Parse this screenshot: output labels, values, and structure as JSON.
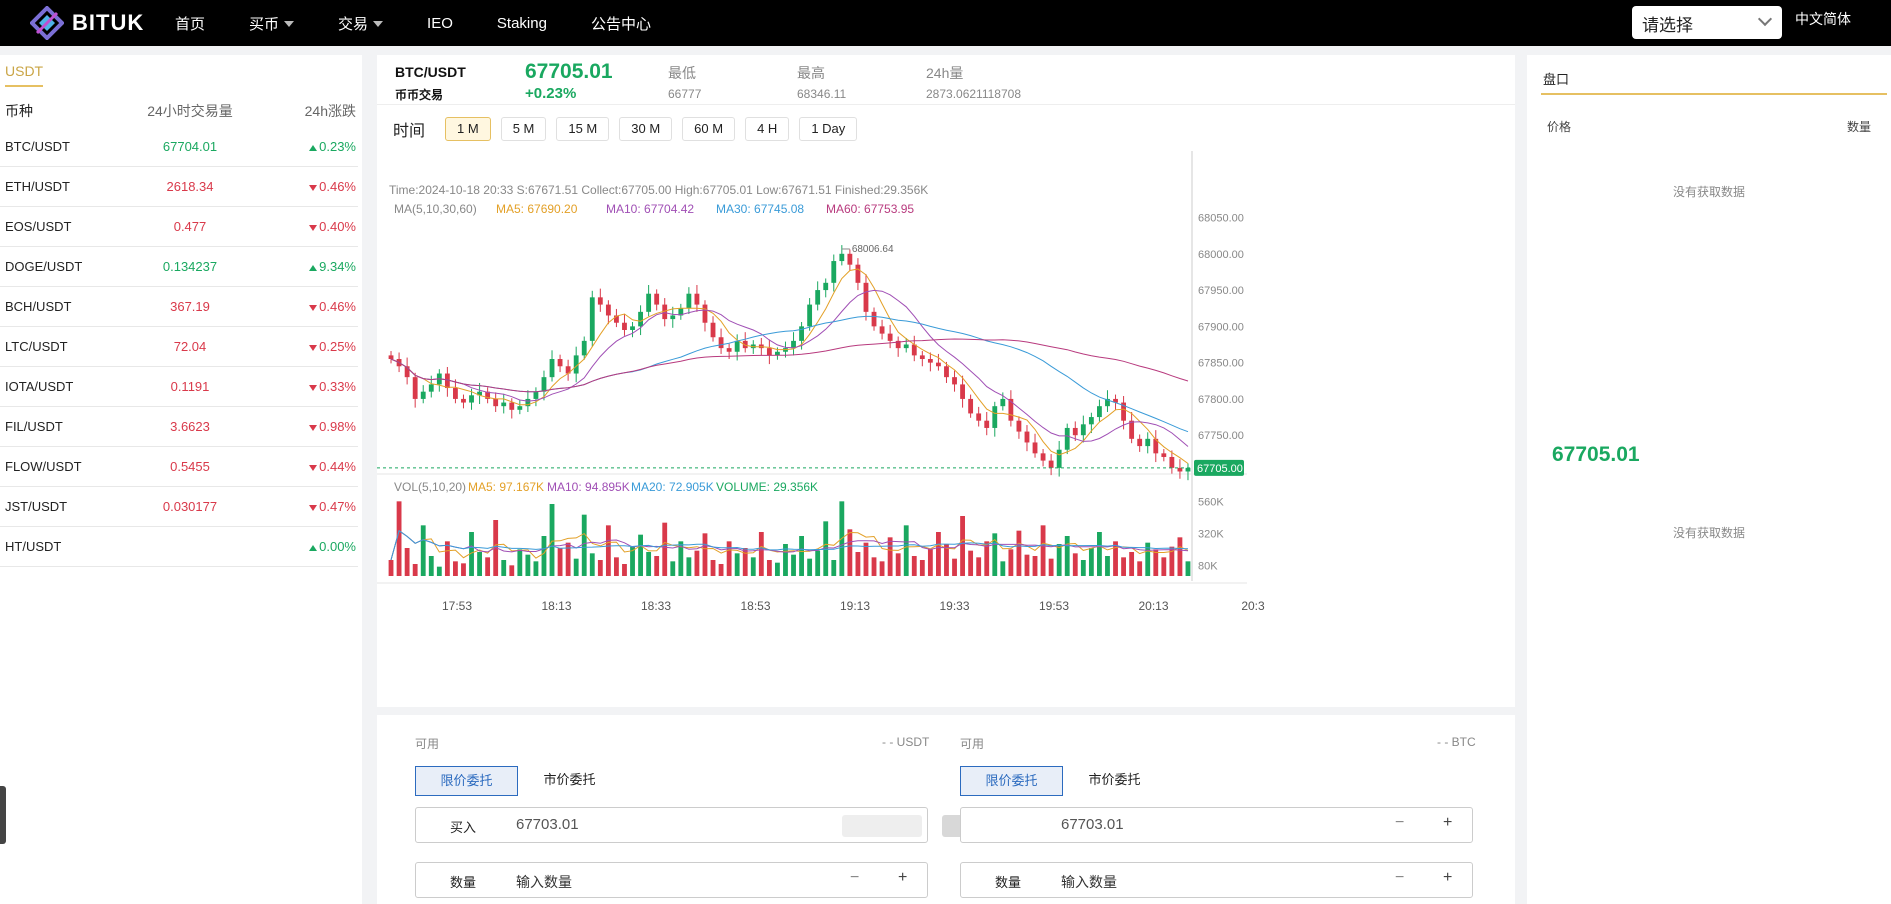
{
  "app": {
    "logo_text": "BITUK",
    "nav": [
      {
        "label": "首页",
        "has_caret": false
      },
      {
        "label": "买币",
        "has_caret": true
      },
      {
        "label": "交易",
        "has_caret": true
      },
      {
        "label": "IEO",
        "has_caret": false
      },
      {
        "label": "Staking",
        "has_caret": false
      },
      {
        "label": "公告中心",
        "has_caret": false
      }
    ],
    "select_placeholder": "请选择",
    "language": "中文简体"
  },
  "colors": {
    "up": "#1aa860",
    "down": "#d9394a",
    "accent": "#e6c062",
    "brand_blue": "#2c6bbf"
  },
  "markets": {
    "tab": "USDT",
    "headers": [
      "币种",
      "24小时交易量",
      "24h涨跌"
    ],
    "rows": [
      {
        "pair": "BTC/USDT",
        "volume": "67704.01",
        "change": "0.23%",
        "dir": "up"
      },
      {
        "pair": "ETH/USDT",
        "volume": "2618.34",
        "change": "0.46%",
        "dir": "down"
      },
      {
        "pair": "EOS/USDT",
        "volume": "0.477",
        "change": "0.40%",
        "dir": "down"
      },
      {
        "pair": "DOGE/USDT",
        "volume": "0.134237",
        "change": "9.34%",
        "dir": "up"
      },
      {
        "pair": "BCH/USDT",
        "volume": "367.19",
        "change": "0.46%",
        "dir": "down"
      },
      {
        "pair": "LTC/USDT",
        "volume": "72.04",
        "change": "0.25%",
        "dir": "down"
      },
      {
        "pair": "IOTA/USDT",
        "volume": "0.1191",
        "change": "0.33%",
        "dir": "down"
      },
      {
        "pair": "FIL/USDT",
        "volume": "3.6623",
        "change": "0.98%",
        "dir": "down"
      },
      {
        "pair": "FLOW/USDT",
        "volume": "0.5455",
        "change": "0.44%",
        "dir": "down"
      },
      {
        "pair": "JST/USDT",
        "volume": "0.030177",
        "change": "0.47%",
        "dir": "down"
      },
      {
        "pair": "HT/USDT",
        "volume": "",
        "change": "0.00%",
        "dir": "up"
      }
    ]
  },
  "ticker": {
    "pair": "BTC/USDT",
    "sub": "币币交易",
    "price": "67705.01",
    "change": "+0.23%",
    "low_label": "最低",
    "low": "66777",
    "high_label": "最高",
    "high": "68346.11",
    "vol_label": "24h量",
    "vol": "2873.0621118708"
  },
  "timeframes": {
    "label": "时间",
    "items": [
      "1 M",
      "5 M",
      "15 M",
      "30 M",
      "60 M",
      "4 H",
      "1 Day"
    ],
    "active": "1 M"
  },
  "chart_data": {
    "type": "candlestick",
    "info_line": "Time:2024-10-18 20:33    S:67671.51    Collect:67705.00    High:67705.01    Low:67671.51    Finished:29.356K",
    "ma_line": {
      "prefix": "MA(5,10,30,60)",
      "items": [
        {
          "text": "MA5: 67690.20",
          "color": "#e3a027"
        },
        {
          "text": "MA10: 67704.42",
          "color": "#a04fb5"
        },
        {
          "text": "MA30: 67745.08",
          "color": "#3a9bd8"
        },
        {
          "text": "MA60: 67753.95",
          "color": "#b83a7e"
        }
      ]
    },
    "price_ticks": [
      "68050.00",
      "68000.00",
      "67950.00",
      "67900.00",
      "67850.00",
      "67800.00",
      "67750.00"
    ],
    "ylim": [
      67680,
      68070
    ],
    "high_marker": "68006.64",
    "last_price_label": "67705.00",
    "last_price": 67705.0,
    "vol_line": {
      "prefix": "VOL(5,10,20)",
      "items": [
        {
          "text": "MA5: 97.167K",
          "color": "#e3a027"
        },
        {
          "text": "MA10: 94.895K",
          "color": "#a04fb5"
        },
        {
          "text": "MA20: 72.905K",
          "color": "#3a9bd8"
        },
        {
          "text": "VOLUME: 29.356K",
          "color": "#1aa860"
        }
      ]
    },
    "volume_ticks": [
      "560K",
      "320K",
      "80K"
    ],
    "x_ticks": [
      "17:53",
      "18:13",
      "18:33",
      "18:53",
      "19:13",
      "19:33",
      "19:53",
      "20:13",
      "20:3"
    ],
    "close_path": [
      67855,
      67845,
      67830,
      67800,
      67810,
      67820,
      67835,
      67815,
      67800,
      67795,
      67805,
      67810,
      67800,
      67790,
      67795,
      67785,
      67790,
      67800,
      67810,
      67830,
      67855,
      67845,
      67835,
      67860,
      67880,
      67940,
      67930,
      67915,
      67905,
      67895,
      67900,
      67920,
      67945,
      67930,
      67910,
      67915,
      67925,
      67945,
      67930,
      67905,
      67885,
      67870,
      67865,
      67880,
      67870,
      67875,
      67870,
      67860,
      67865,
      67870,
      67880,
      67900,
      67930,
      67950,
      67960,
      67990,
      68000,
      67985,
      67960,
      67920,
      67900,
      67890,
      67880,
      67870,
      67875,
      67860,
      67855,
      67850,
      67845,
      67830,
      67820,
      67800,
      67780,
      67770,
      67760,
      67790,
      67800,
      67770,
      67755,
      67740,
      67725,
      67715,
      67705,
      67730,
      67760,
      67750,
      67765,
      67775,
      67790,
      67800,
      67795,
      67770,
      67745,
      67735,
      67745,
      67725,
      67720,
      67705,
      67700,
      67705
    ],
    "volumes": [
      120,
      560,
      210,
      90,
      380,
      150,
      70,
      260,
      110,
      95,
      330,
      180,
      140,
      420,
      120,
      80,
      200,
      160,
      110,
      300,
      540,
      210,
      250,
      130,
      460,
      170,
      120,
      380,
      140,
      90,
      220,
      310,
      180,
      150,
      400,
      110,
      260,
      140,
      190,
      320,
      120,
      90,
      260,
      170,
      210,
      140,
      330,
      120,
      100,
      240,
      160,
      300,
      130,
      190,
      410,
      120,
      560,
      350,
      180,
      250,
      140,
      110,
      290,
      170,
      380,
      150,
      120,
      200,
      330,
      240,
      130,
      450,
      190,
      140,
      260,
      320,
      110,
      200,
      340,
      160,
      150,
      380,
      130,
      240,
      300,
      170,
      120,
      210,
      330,
      150,
      260,
      140,
      180,
      110,
      250,
      200,
      140,
      220,
      290,
      110
    ]
  },
  "order": {
    "available_label": "可用",
    "buy_unit": "- - USDT",
    "sell_unit": "- - BTC",
    "limit_tab": "限价委托",
    "market_tab": "市价委托",
    "buy_price_label": "买入",
    "price_value": "67703.01",
    "qty_label": "数量",
    "qty_placeholder": "输入数量",
    "minus": "−",
    "plus": "+"
  },
  "orderbook": {
    "title": "盘口",
    "col_price": "价格",
    "col_qty": "数量",
    "empty": "没有获取数据",
    "mid_price": "67705.01"
  }
}
